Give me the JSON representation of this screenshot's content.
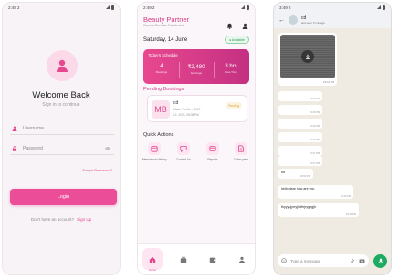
{
  "login_screen": {
    "status_time": "2:49",
    "status_extra": "2",
    "title": "Welcome Back",
    "subtitle": "Sign in to continue",
    "username_placeholder": "Username",
    "password_placeholder": "Password",
    "forgot": "Forgot Password?",
    "login_button": "Login",
    "signup_prompt": "Don't have an account?",
    "signup_link": "Sign Up",
    "accent": "#ec4d98"
  },
  "dashboard_screen": {
    "status_time": "2:49",
    "status_extra": "2",
    "app_title": "Beauty Partner",
    "app_subtitle": "Service Provider Dashboard",
    "date": "Saturday, 14 June",
    "availability": "Available",
    "schedule": {
      "title": "Today's Schedule",
      "stats": [
        {
          "value": "4",
          "label": "Bookings"
        },
        {
          "value": "₹2,480",
          "label": "Earnings"
        },
        {
          "value": "3 hrs",
          "label": "Free Time"
        }
      ]
    },
    "pending_title": "Pending Bookings",
    "booking": {
      "initials": "MB",
      "name": "cd",
      "detail": "Water Purifier • 5000",
      "time": "12, 2025, 08:08 PM",
      "status": "Pending"
    },
    "quick_title": "Quick Actions",
    "quick_actions": [
      {
        "label": "Attendance History",
        "icon": "calendar-icon"
      },
      {
        "label": "Contact Us",
        "icon": "chat-icon"
      },
      {
        "label": "Reports",
        "icon": "card-icon"
      },
      {
        "label": "Order parts",
        "icon": "document-icon"
      }
    ],
    "nav": {
      "home_label": "Home"
    }
  },
  "chat_screen": {
    "status_time": "3:49",
    "status_extra": "2",
    "contact_name": "cd",
    "contact_status": "last seen 5 min ago",
    "image_time": "03:44 PM",
    "messages": [
      {
        "text": "",
        "time": "03:45 PM"
      },
      {
        "text": "",
        "time": "03:46 PM"
      },
      {
        "text": "",
        "time": "03:46 PM"
      },
      {
        "text": "",
        "time": "03:46 PM"
      },
      {
        "text": "",
        "time": "03:47 PM"
      },
      {
        "text": "",
        "time": "03:47 PM"
      },
      {
        "text": "hd",
        "time": "03:50 PM"
      },
      {
        "text": "hello dear how are you",
        "time": "04:15 PM"
      },
      {
        "text": "thyyyujyrryjhdfrrjrygjrgjh",
        "time": "04:15 PM"
      }
    ],
    "input_placeholder": "Type a message"
  }
}
